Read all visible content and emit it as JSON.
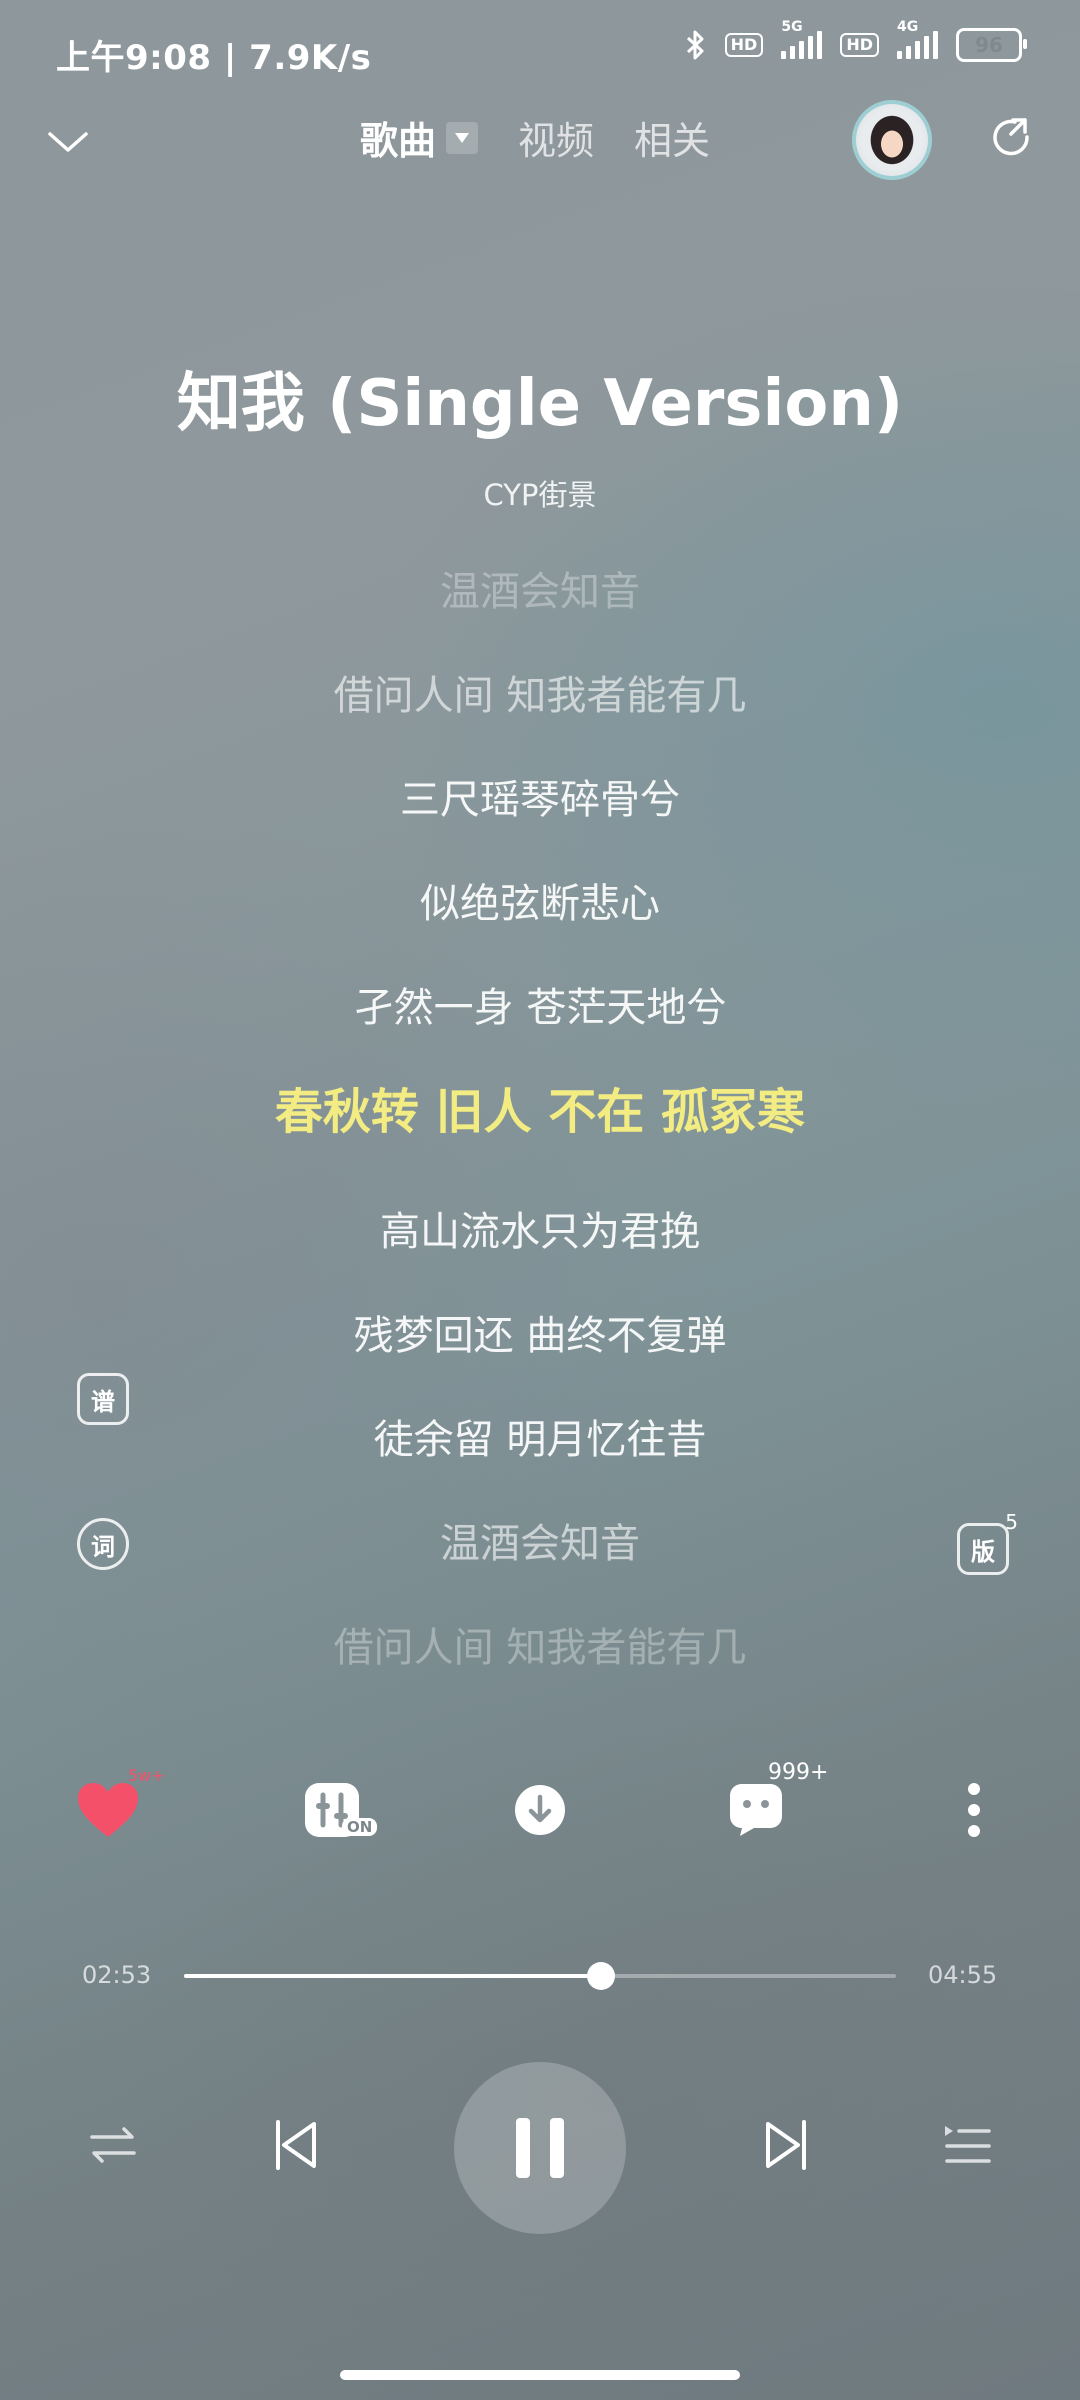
{
  "status": {
    "time": "上午9:08 | 7.9K/s",
    "hd1": "HD",
    "net1": "5G",
    "hd2": "HD",
    "net2": "4G",
    "battery": "96"
  },
  "nav": {
    "tab_song": "歌曲",
    "tab_video": "视频",
    "tab_related": "相关"
  },
  "song": {
    "title": "知我 (Single Version)",
    "artist": "CYP街景"
  },
  "lyrics": [
    "温酒会知音",
    "借问人间 知我者能有几",
    "三尺瑶琴碎骨兮",
    "似绝弦断悲心",
    "孑然一身 苍茫天地兮",
    "春秋转 旧人 不在 孤冢寒",
    "高山流水只为君挽",
    "残梦回还 曲终不复弹",
    "徒余留 明月忆往昔",
    "温酒会知音",
    "借问人间 知我者能有几"
  ],
  "lyrics_current_index": 5,
  "side": {
    "score_label": "谱",
    "lyric_label": "词",
    "version_label": "版",
    "version_count": "5"
  },
  "actions": {
    "like_badge": "5w+",
    "effect_badge": "ON",
    "comment_count": "999+"
  },
  "progress": {
    "elapsed": "02:53",
    "total": "04:55",
    "fraction": 0.586
  },
  "colors": {
    "current_lyric": "#f2ec83",
    "like": "#f5506a"
  }
}
